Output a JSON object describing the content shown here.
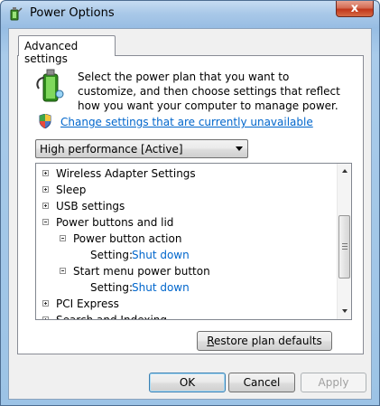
{
  "window": {
    "title": "Power Options",
    "close_label": "x"
  },
  "tab": {
    "label": "Advanced settings"
  },
  "description": "Select the power plan that you want to customize, and then choose settings that reflect how you want your computer to manage power.",
  "change_settings_link": "Change settings that are currently unavailable",
  "plan_select": {
    "value": "High performance [Active]"
  },
  "tree": {
    "items": [
      {
        "label": "Wireless Adapter Settings",
        "expander": "plus"
      },
      {
        "label": "Sleep",
        "expander": "plus"
      },
      {
        "label": "USB settings",
        "expander": "plus"
      },
      {
        "label": "Power buttons and lid",
        "expander": "minus"
      },
      {
        "label": "Power button action",
        "expander": "minus"
      },
      {
        "label": "Setting:",
        "value": "Shut down"
      },
      {
        "label": "Start menu power button",
        "expander": "minus"
      },
      {
        "label": "Setting:",
        "value": "Shut down"
      },
      {
        "label": "PCI Express",
        "expander": "plus"
      },
      {
        "label": "Search and Indexing",
        "expander": "plus"
      }
    ]
  },
  "buttons": {
    "restore_first": "R",
    "restore_rest": "estore plan defaults",
    "ok": "OK",
    "cancel": "Cancel",
    "apply": "Apply"
  }
}
